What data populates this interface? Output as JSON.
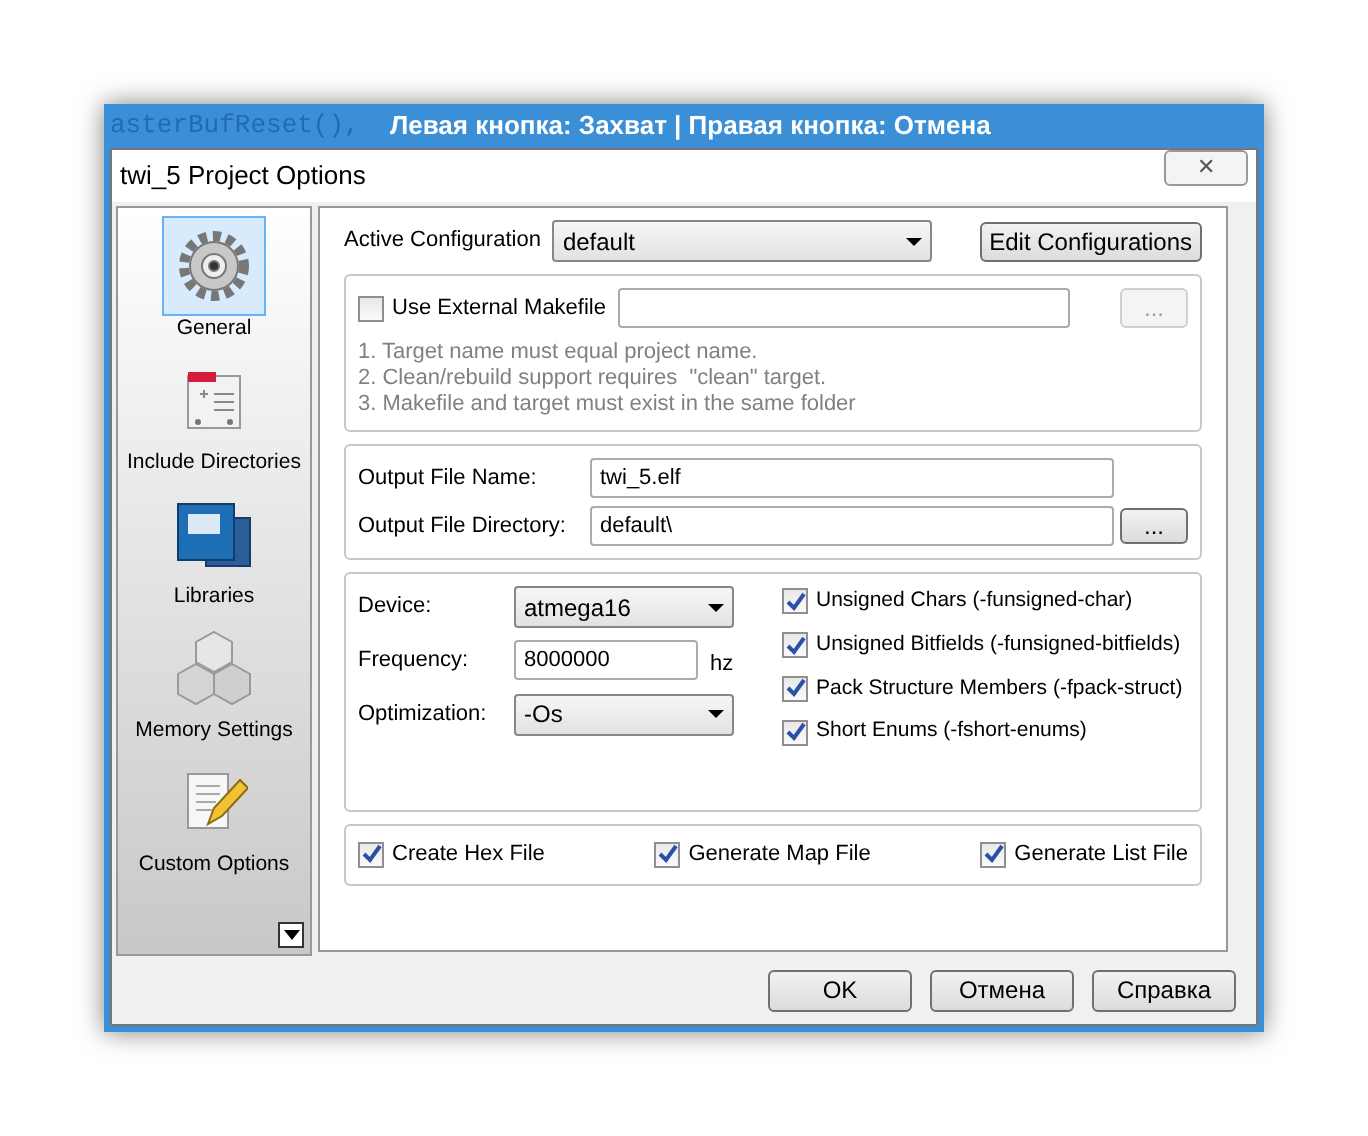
{
  "capture_bar": {
    "hint": "Левая кнопка: Захват | Правая кнопка: Отмена",
    "code_behind": "asterBufReset(),"
  },
  "window": {
    "title": "twi_5 Project Options",
    "close": "✕"
  },
  "sidebar": {
    "items": [
      {
        "label": "General",
        "kind": "gear",
        "selected": true
      },
      {
        "label": "Include Directories",
        "kind": "folder",
        "selected": false
      },
      {
        "label": "Libraries",
        "kind": "book",
        "selected": false
      },
      {
        "label": "Memory Settings",
        "kind": "cubes",
        "selected": false
      },
      {
        "label": "Custom Options",
        "kind": "pencil",
        "selected": false
      }
    ]
  },
  "active_configuration": {
    "label": "Active Configuration",
    "value": "default",
    "button": "Edit Configurations"
  },
  "makefile": {
    "label": "Use External Makefile",
    "checked": false,
    "browse": {
      "label": "...",
      "disabled": true
    },
    "notes": [
      "1. Target name must equal project name.",
      "2. Clean/rebuild support requires  \"clean\" target.",
      "3. Makefile and target must exist in the same folder"
    ]
  },
  "output": {
    "name_label": "Output File Name:",
    "name": "twi_5.elf",
    "dir_label": "Output File Directory:",
    "dir": "default\\",
    "browse": {
      "label": "...",
      "disabled": false
    }
  },
  "device": {
    "device_label": "Device:",
    "device": "atmega16",
    "frequency_label": "Frequency:",
    "frequency": "8000000",
    "unit": "hz",
    "optimization_label": "Optimization:",
    "optimization": "-Os"
  },
  "flags": [
    {
      "label": "Unsigned Chars (-funsigned-char)",
      "checked": true
    },
    {
      "label": "Unsigned Bitfields (-funsigned-bitfields)",
      "checked": true
    },
    {
      "label": "Pack Structure Members (-fpack-struct)",
      "checked": true
    },
    {
      "label": "Short Enums (-fshort-enums)",
      "checked": true
    }
  ],
  "files": [
    {
      "label": "Create Hex File",
      "checked": true
    },
    {
      "label": "Generate Map File",
      "checked": true
    },
    {
      "label": "Generate List File",
      "checked": true
    }
  ],
  "buttons": [
    "OK",
    "Отмена",
    "Справка"
  ]
}
